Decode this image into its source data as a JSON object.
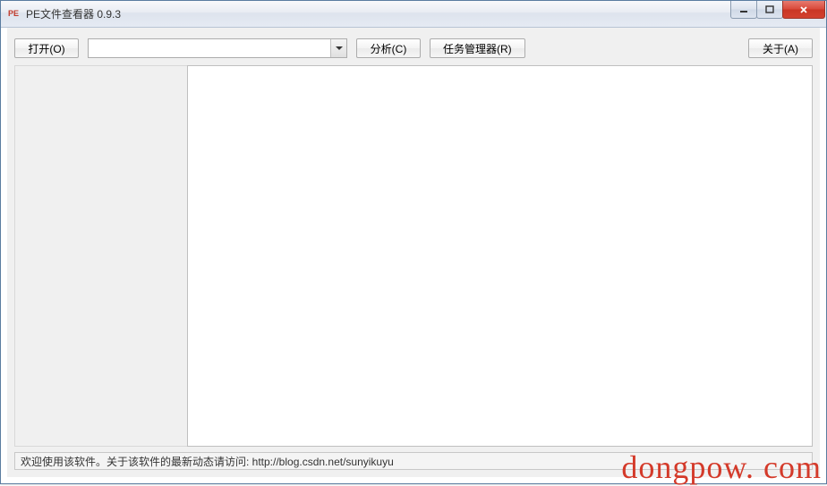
{
  "window": {
    "icon_text": "PE",
    "title": "PE文件查看器 0.9.3"
  },
  "toolbar": {
    "open_label": "打开(O)",
    "combo_value": "",
    "analyze_label": "分析(C)",
    "taskmgr_label": "任务管理器(R)",
    "about_label": "关于(A)"
  },
  "status": {
    "text": "欢迎使用该软件。关于该软件的最新动态请访问: http://blog.csdn.net/sunyikuyu"
  },
  "watermark": "dongpow. com"
}
